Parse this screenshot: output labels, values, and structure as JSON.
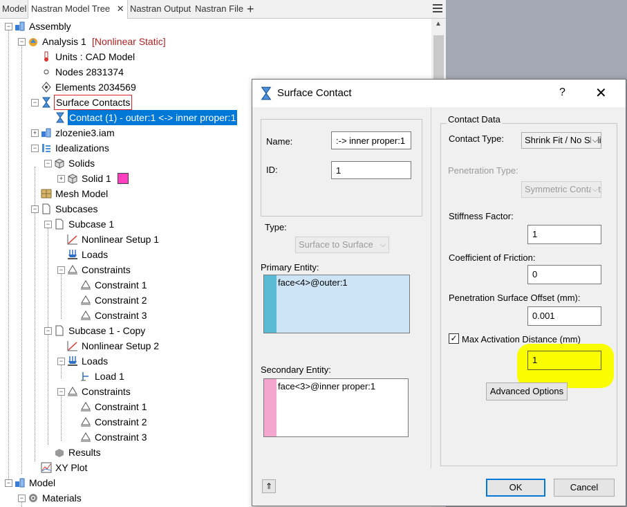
{
  "tabs": {
    "model": "Model",
    "nastran_model_tree": "Nastran Model Tree",
    "close": "✕",
    "nastran_output": "Nastran Output",
    "nastran_file": "Nastran File",
    "add": "+"
  },
  "tree": {
    "assembly": "Assembly",
    "analysis": "Analysis 1",
    "analysis_type": "[Nonlinear Static]",
    "units": "Units : CAD Model",
    "nodes": "Nodes 2831374",
    "elements": "Elements 2034569",
    "surface_contacts": "Surface Contacts",
    "contact": "Contact (1) - outer:1 <-> inner proper:1",
    "part": "zlozenie3.iam",
    "idealizations": "Idealizations",
    "solids": "Solids",
    "solid1": "Solid 1",
    "mesh_model": "Mesh Model",
    "subcases": "Subcases",
    "subcase1": "Subcase 1",
    "nl_setup1": "Nonlinear Setup 1",
    "loads1": "Loads",
    "constraints1": "Constraints",
    "c1_1": "Constraint 1",
    "c1_2": "Constraint 2",
    "c1_3": "Constraint 3",
    "subcase2": "Subcase 1 - Copy",
    "nl_setup2": "Nonlinear Setup 2",
    "loads2": "Loads",
    "load1": "Load 1",
    "constraints2": "Constraints",
    "c2_1": "Constraint 1",
    "c2_2": "Constraint 2",
    "c2_3": "Constraint 3",
    "results": "Results",
    "xy_plot": "XY Plot",
    "model": "Model",
    "materials": "Materials",
    "solid_swatch_color": "#ff3fbf"
  },
  "dialog": {
    "title": "Surface Contact",
    "help": "?",
    "close": "✕",
    "name_label": "Name:",
    "name_value": ":-> inner proper:1",
    "id_label": "ID:",
    "id_value": "1",
    "type_label": "Type:",
    "type_value": "Surface to Surface",
    "primary_label": "Primary Entity:",
    "primary_value": "face<4>@outer:1",
    "primary_color": "#5bbad5",
    "secondary_label": "Secondary Entity:",
    "secondary_value": "face<3>@inner proper:1",
    "secondary_color": "#f4a6cf",
    "contact_data_label": "Contact Data",
    "contact_type_label": "Contact Type:",
    "contact_type_value": "Shrink Fit / No Sliding",
    "penetration_type_label": "Penetration Type:",
    "penetration_type_value": "Symmetric Contact",
    "stiffness_label": "Stiffness Factor:",
    "stiffness_value": "1",
    "friction_label": "Coefficient of Friction:",
    "friction_value": "0",
    "offset_label": "Penetration Surface Offset (mm):",
    "offset_value": "0.001",
    "max_act_label": "Max Activation Distance (mm)",
    "max_act_checked": "✓",
    "max_act_value": "1",
    "advanced": "Advanced Options",
    "ok": "OK",
    "cancel": "Cancel",
    "collapse": "⇑",
    "highlight_color": "#fafd00"
  }
}
